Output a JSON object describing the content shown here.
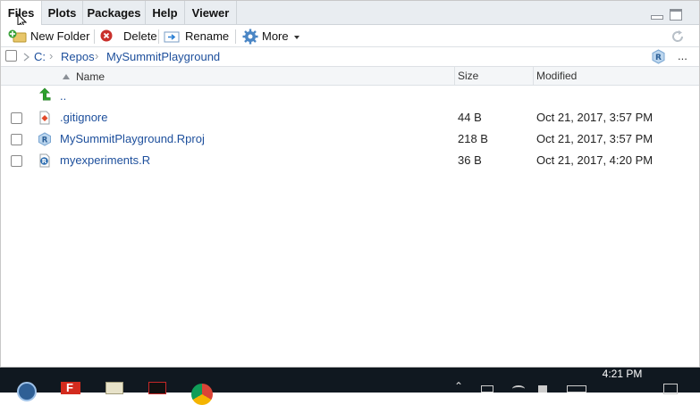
{
  "tabs": [
    {
      "label": "Files"
    },
    {
      "label": "Plots"
    },
    {
      "label": "Packages"
    },
    {
      "label": "Help"
    },
    {
      "label": "Viewer"
    }
  ],
  "toolbar": {
    "new_folder": "New Folder",
    "delete": "Delete",
    "rename": "Rename",
    "more": "More"
  },
  "breadcrumb": [
    "C:",
    "Repos",
    "MySummitPlayground"
  ],
  "overflow_label": "...",
  "columns": {
    "name": "Name",
    "size": "Size",
    "modified": "Modified"
  },
  "parent_dir_label": "..",
  "files": [
    {
      "name": ".gitignore",
      "size": "44 B",
      "modified": "Oct 21, 2017, 3:57 PM",
      "icon": "gitignore-file-icon"
    },
    {
      "name": "MySummitPlayground.Rproj",
      "size": "218 B",
      "modified": "Oct 21, 2017, 3:57 PM",
      "icon": "rproj-file-icon"
    },
    {
      "name": "myexperiments.R",
      "size": "36 B",
      "modified": "Oct 21, 2017, 4:20 PM",
      "icon": "r-script-file-icon"
    }
  ],
  "taskbar": {
    "clock": "4:21 PM"
  },
  "colors": {
    "link": "#1d4f9c",
    "tab_bar": "#e9edf1",
    "taskbar": "#101820"
  }
}
